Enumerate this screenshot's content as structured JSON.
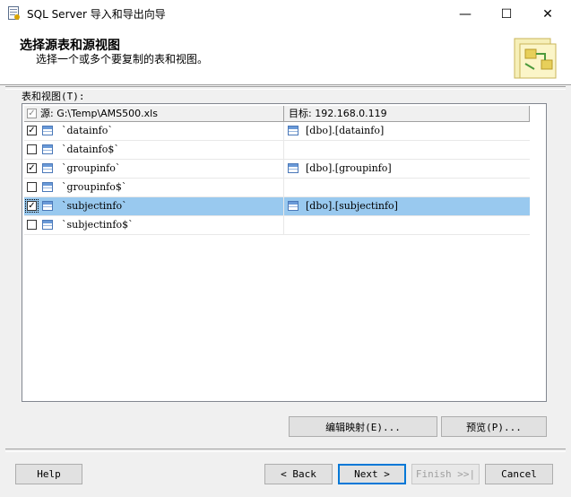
{
  "window": {
    "title": "SQL Server 导入和导出向导",
    "minimize": "—",
    "maximize": "☐",
    "close": "✕"
  },
  "header": {
    "title": "选择源表和源视图",
    "subtitle": "选择一个或多个要复制的表和视图。"
  },
  "section_label": "表和视图(T):",
  "grid": {
    "source_header": "源: G:\\Temp\\AMS500.xls",
    "dest_header": "目标: 192.168.0.119",
    "rows": [
      {
        "source": "`datainfo`",
        "dest": "[dbo].[datainfo]",
        "checked": true
      },
      {
        "source": "`datainfo$`",
        "dest": "",
        "checked": false
      },
      {
        "source": "`groupinfo`",
        "dest": "[dbo].[groupinfo]",
        "checked": true
      },
      {
        "source": "`groupinfo$`",
        "dest": "",
        "checked": false
      },
      {
        "source": "`subjectinfo`",
        "dest": "[dbo].[subjectinfo]",
        "checked": true,
        "selected": true
      },
      {
        "source": "`subjectinfo$`",
        "dest": "",
        "checked": false
      }
    ]
  },
  "buttons": {
    "edit_mappings": "编辑映射(E)...",
    "preview": "预览(P)...",
    "help": "Help",
    "back": "< Back",
    "next": "Next >",
    "finish": "Finish >>|",
    "cancel": "Cancel"
  }
}
